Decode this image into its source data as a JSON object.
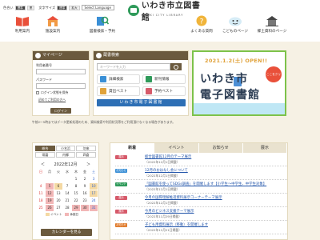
{
  "header": {
    "util": {
      "color_label": "色合い",
      "color_std": "標準",
      "color_black": "黒",
      "size_label": "文字サイズ",
      "size_std": "標準",
      "size_large": "拡大",
      "lang_label": "Select Language"
    },
    "logo_title": "いわき市立図書館",
    "logo_sub": "IWAKI CITY LIBRARY",
    "nav": [
      {
        "label": "利用案内",
        "icon": "book-guide-icon"
      },
      {
        "label": "施設案内",
        "icon": "building-icon"
      },
      {
        "label": "図書検索・予約",
        "icon": "book-search-icon"
      },
      {
        "label": "よくある質問",
        "icon": "question-icon"
      },
      {
        "label": "こどものページ",
        "icon": "kids-icon"
      },
      {
        "label": "郷土資料のページ",
        "icon": "local-history-icon"
      }
    ]
  },
  "login": {
    "title": "マイページ",
    "id_label": "利用者番号",
    "password_label": "パスワード",
    "remember_label": "ログイン状態を保持",
    "forgot_link": "初めてご利用の方へ",
    "button": "ログイン"
  },
  "search": {
    "title": "蔵書検索",
    "placeholder": "キーワードを入力",
    "items": [
      {
        "label": "詳細検索",
        "color": "#3a8fd6"
      },
      {
        "label": "新刊情報",
        "color": "#2f9a5a"
      },
      {
        "label": "貸出ベスト",
        "color": "#e0a23a"
      },
      {
        "label": "予約ベスト",
        "color": "#d65a6a"
      }
    ],
    "banner": "いわき市電子図書館"
  },
  "ebanner": {
    "date": "2021.1.2(土) OPEN!!",
    "line1": "いわき市",
    "line2": "電子図書館",
    "tag": "ここをクリック!",
    "colors": {
      "border": "#7dc24a",
      "text": "#2a3b52",
      "accent": "#e0a23a"
    }
  },
  "notice": "午前2〜5時まではデータ更新処理のため、資料検索や利用状況等をご利用頂けなくなる場合があります。",
  "calendar": {
    "tabs": [
      "総合",
      "小名浜",
      "勿来",
      "常磐",
      "内郷",
      "四倉"
    ],
    "active_tab": 0,
    "prev": "＜",
    "month": "2022年12月",
    "next": "＞",
    "weekdays": [
      "日",
      "月",
      "火",
      "水",
      "木",
      "金",
      "土"
    ],
    "days": [
      "",
      "",
      "",
      "",
      "1",
      "2",
      "3",
      "4",
      "5",
      "6",
      "7",
      "8",
      "9",
      "10",
      "11",
      "12",
      "13",
      "14",
      "15",
      "16",
      "17",
      "18",
      "19",
      "20",
      "21",
      "22",
      "23",
      "24",
      "25",
      "26",
      "27",
      "28",
      "29",
      "30",
      "31"
    ],
    "legend": {
      "event": "イベント",
      "closed": "休館日"
    },
    "button": "カレンダーを見る"
  },
  "news": {
    "tabs": [
      "新着",
      "イベント",
      "お知らせ",
      "展示"
    ],
    "items": [
      {
        "badge": "展示",
        "badge_color": "#d65a6a",
        "title": "総合図書館12月のテーマ展示",
        "date": "（2022年12月1日掲載）"
      },
      {
        "badge": "お知らせ",
        "badge_color": "#3a8fd6",
        "title": "12月のおはなし会について",
        "date": "（2022年12月1日掲載）"
      },
      {
        "badge": "イベント",
        "badge_color": "#2f9a5a",
        "title": "「図書館を使ってSDGs調査」を開催します【小学生〜中学生、中学生対象】",
        "date": "（2022年12月1日掲載）"
      },
      {
        "badge": "展示",
        "badge_color": "#d65a6a",
        "title": "今月の国際理解推進資料展示コーナーテーマ展示",
        "date": "（2022年12月1日掲載）"
      },
      {
        "badge": "展示",
        "badge_color": "#d65a6a",
        "title": "今月のビジネス支援テーマ展示",
        "date": "（2022年11月29日掲載）"
      },
      {
        "badge": "お知らせ",
        "badge_color": "#e07a2a",
        "title": "子ども用資料展示（移動）を開催します",
        "date": "（2022年11月21日掲載）"
      }
    ]
  }
}
